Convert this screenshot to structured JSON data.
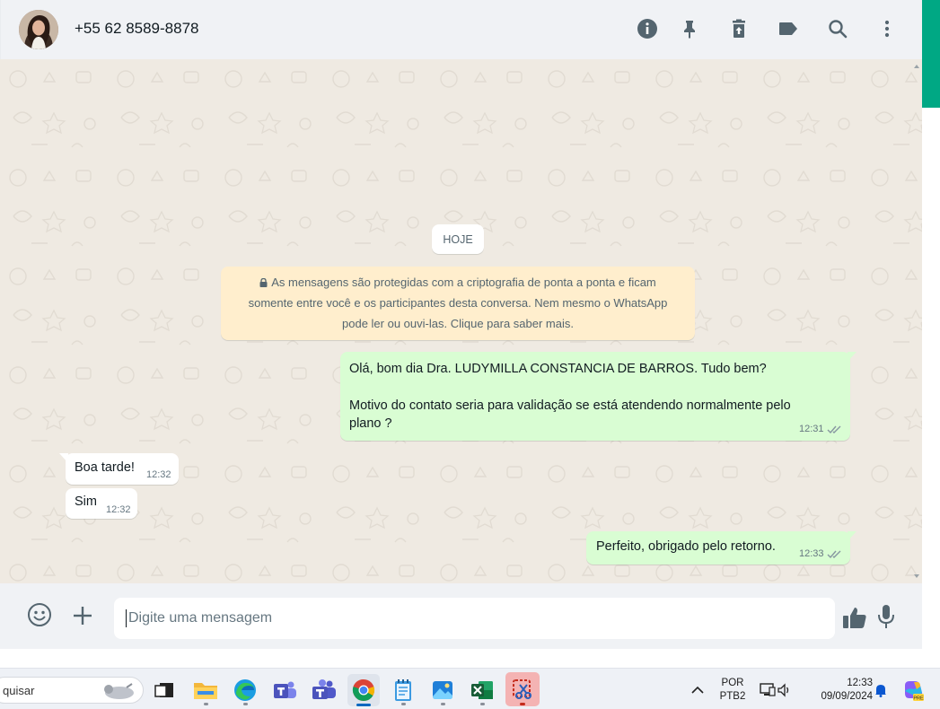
{
  "header": {
    "contact_name": "+55 62 8589-8878",
    "icons": [
      "info-icon",
      "pin-icon",
      "delete-icon",
      "label-icon",
      "search-icon",
      "menu-icon"
    ]
  },
  "chat": {
    "date_chip": "HOJE",
    "encryption_notice": {
      "line1": "As mensagens são protegidas com a criptografia de ponta a ponta e ficam",
      "line2": "somente entre você e os participantes desta conversa. Nem mesmo o WhatsApp",
      "line3": "pode ler ou ouvi-las. Clique para saber mais."
    },
    "messages": [
      {
        "direction": "out",
        "line1": "Olá, bom dia Dra. LUDYMILLA CONSTANCIA DE BARROS. Tudo bem?",
        "line2": "Motivo do contato seria para validação se está atendendo normalmente pelo",
        "line3": "plano ?",
        "time": "12:31",
        "status": "read"
      },
      {
        "direction": "in",
        "text": "Boa tarde!",
        "time": "12:32"
      },
      {
        "direction": "in",
        "text": "Sim",
        "time": "12:32"
      },
      {
        "direction": "out",
        "text": "Perfeito, obrigado pelo retorno.",
        "time": "12:33",
        "status": "read"
      }
    ]
  },
  "composer": {
    "placeholder": "Digite uma mensagem",
    "icons": [
      "emoji-icon",
      "attach-plus-icon",
      "thumbs-up-icon",
      "microphone-icon"
    ]
  },
  "taskbar": {
    "search_text": "quisar",
    "apps": [
      "task-view",
      "file-explorer",
      "edge",
      "teams",
      "teams-classic",
      "chrome",
      "notepad",
      "photos",
      "excel",
      "snipping-tool"
    ],
    "lang_line1": "POR",
    "lang_line2": "PTB2",
    "clock_time": "12:33",
    "clock_date": "09/09/2024"
  },
  "colors": {
    "accent": "#00a884",
    "outgoing_bubble": "#d9fdd3",
    "incoming_bubble": "#ffffff",
    "notice_bg": "#ffeecd",
    "chat_bg": "#efeae2",
    "read_ticks": "#8696a0"
  }
}
